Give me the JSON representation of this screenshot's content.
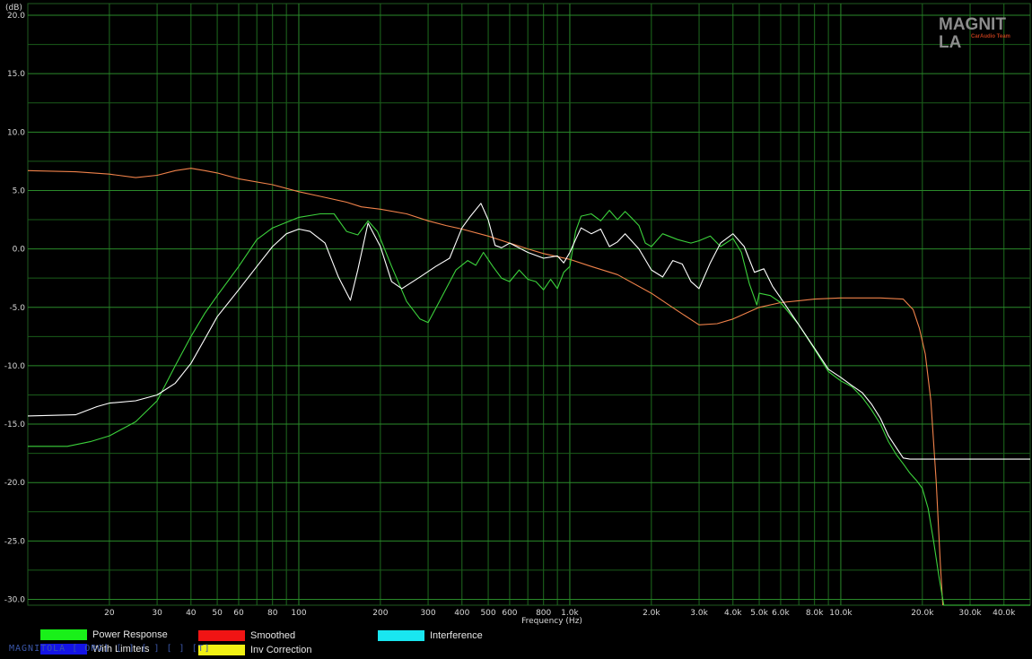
{
  "chart_data": {
    "type": "line",
    "xscale": "log",
    "xlim": [
      10,
      50000
    ],
    "ylim": [
      -30.5,
      21
    ],
    "ylabel": "(dB)",
    "xlabel": "Frequency (Hz)",
    "grid": true,
    "legend_position": "bottom",
    "y_ticks": [
      "20.0",
      "15.0",
      "10.0",
      "5.0",
      "0.0",
      "-5.0",
      "-10.0",
      "-15.0",
      "-20.0",
      "-25.0",
      "-30.0"
    ],
    "x_ticks": [
      {
        "f": 20,
        "label": "20"
      },
      {
        "f": 30,
        "label": "30"
      },
      {
        "f": 40,
        "label": "40"
      },
      {
        "f": 50,
        "label": "50"
      },
      {
        "f": 60,
        "label": "60"
      },
      {
        "f": 80,
        "label": "80"
      },
      {
        "f": 100,
        "label": "100"
      },
      {
        "f": 200,
        "label": "200"
      },
      {
        "f": 300,
        "label": "300"
      },
      {
        "f": 400,
        "label": "400"
      },
      {
        "f": 500,
        "label": "500"
      },
      {
        "f": 600,
        "label": "600"
      },
      {
        "f": 800,
        "label": "800"
      },
      {
        "f": 1000,
        "label": "1.0k"
      },
      {
        "f": 2000,
        "label": "2.0k"
      },
      {
        "f": 3000,
        "label": "3.0k"
      },
      {
        "f": 4000,
        "label": "4.0k"
      },
      {
        "f": 5000,
        "label": "5.0k"
      },
      {
        "f": 6000,
        "label": "6.0k"
      },
      {
        "f": 8000,
        "label": "8.0k"
      },
      {
        "f": 10000,
        "label": "10.0k"
      },
      {
        "f": 20000,
        "label": "20.0k"
      },
      {
        "f": 30000,
        "label": "30.0k"
      },
      {
        "f": 40000,
        "label": "40.0k"
      }
    ],
    "series": [
      {
        "name": "Inv Correction",
        "color": "#f0824a",
        "points": [
          [
            10,
            6.7
          ],
          [
            15,
            6.6
          ],
          [
            20,
            6.4
          ],
          [
            25,
            6.1
          ],
          [
            30,
            6.3
          ],
          [
            35,
            6.7
          ],
          [
            40,
            6.9
          ],
          [
            45,
            6.7
          ],
          [
            50,
            6.5
          ],
          [
            60,
            6.0
          ],
          [
            80,
            5.5
          ],
          [
            100,
            4.9
          ],
          [
            120,
            4.5
          ],
          [
            150,
            4.0
          ],
          [
            170,
            3.6
          ],
          [
            200,
            3.4
          ],
          [
            250,
            3.0
          ],
          [
            300,
            2.4
          ],
          [
            350,
            2.0
          ],
          [
            400,
            1.7
          ],
          [
            500,
            1.1
          ],
          [
            600,
            0.5
          ],
          [
            700,
            0.0
          ],
          [
            800,
            -0.4
          ],
          [
            1000,
            -0.9
          ],
          [
            1200,
            -1.5
          ],
          [
            1500,
            -2.2
          ],
          [
            2000,
            -3.8
          ],
          [
            2500,
            -5.3
          ],
          [
            3000,
            -6.5
          ],
          [
            3500,
            -6.4
          ],
          [
            4000,
            -6.0
          ],
          [
            5000,
            -5.0
          ],
          [
            6000,
            -4.6
          ],
          [
            8000,
            -4.3
          ],
          [
            10000,
            -4.2
          ],
          [
            14000,
            -4.2
          ],
          [
            17000,
            -4.3
          ],
          [
            18500,
            -5.2
          ],
          [
            19500,
            -6.8
          ],
          [
            20500,
            -9.0
          ],
          [
            21500,
            -13.0
          ],
          [
            22500,
            -20.0
          ],
          [
            23300,
            -27.0
          ],
          [
            23800,
            -30.5
          ]
        ]
      },
      {
        "name": "Power Response",
        "color": "#3cd23c",
        "points": [
          [
            10,
            -16.9
          ],
          [
            14,
            -16.9
          ],
          [
            17,
            -16.5
          ],
          [
            20,
            -16.0
          ],
          [
            25,
            -14.8
          ],
          [
            30,
            -13.0
          ],
          [
            35,
            -10.0
          ],
          [
            40,
            -7.5
          ],
          [
            45,
            -5.5
          ],
          [
            50,
            -4.0
          ],
          [
            60,
            -1.5
          ],
          [
            70,
            0.8
          ],
          [
            80,
            1.8
          ],
          [
            100,
            2.7
          ],
          [
            120,
            3.0
          ],
          [
            135,
            3.0
          ],
          [
            150,
            1.5
          ],
          [
            165,
            1.2
          ],
          [
            180,
            2.4
          ],
          [
            195,
            1.5
          ],
          [
            220,
            -1.5
          ],
          [
            250,
            -4.5
          ],
          [
            280,
            -6.0
          ],
          [
            300,
            -6.3
          ],
          [
            330,
            -4.5
          ],
          [
            380,
            -1.8
          ],
          [
            420,
            -1.0
          ],
          [
            450,
            -1.4
          ],
          [
            480,
            -0.3
          ],
          [
            520,
            -1.5
          ],
          [
            560,
            -2.5
          ],
          [
            600,
            -2.8
          ],
          [
            650,
            -1.8
          ],
          [
            700,
            -2.6
          ],
          [
            750,
            -2.8
          ],
          [
            800,
            -3.5
          ],
          [
            850,
            -2.6
          ],
          [
            900,
            -3.4
          ],
          [
            950,
            -2.0
          ],
          [
            1000,
            -1.5
          ],
          [
            1050,
            1.5
          ],
          [
            1100,
            2.8
          ],
          [
            1200,
            3.0
          ],
          [
            1300,
            2.4
          ],
          [
            1400,
            3.3
          ],
          [
            1500,
            2.5
          ],
          [
            1600,
            3.2
          ],
          [
            1700,
            2.6
          ],
          [
            1800,
            2.0
          ],
          [
            1900,
            0.5
          ],
          [
            2000,
            0.2
          ],
          [
            2200,
            1.3
          ],
          [
            2500,
            0.8
          ],
          [
            2800,
            0.5
          ],
          [
            3000,
            0.7
          ],
          [
            3300,
            1.1
          ],
          [
            3600,
            0.2
          ],
          [
            4000,
            0.9
          ],
          [
            4300,
            -0.3
          ],
          [
            4600,
            -3.0
          ],
          [
            4900,
            -4.8
          ],
          [
            5000,
            -3.8
          ],
          [
            5500,
            -4.0
          ],
          [
            6000,
            -4.6
          ],
          [
            7000,
            -6.5
          ],
          [
            8000,
            -8.6
          ],
          [
            9000,
            -10.5
          ],
          [
            10000,
            -11.3
          ],
          [
            11000,
            -11.8
          ],
          [
            12000,
            -12.7
          ],
          [
            13000,
            -13.8
          ],
          [
            14000,
            -15.0
          ],
          [
            15000,
            -16.5
          ],
          [
            16000,
            -17.6
          ],
          [
            17000,
            -18.4
          ],
          [
            18000,
            -19.2
          ],
          [
            19000,
            -19.8
          ],
          [
            20000,
            -20.5
          ],
          [
            21000,
            -22.2
          ],
          [
            22000,
            -25.0
          ],
          [
            23000,
            -28.0
          ],
          [
            24000,
            -30.5
          ],
          [
            50000,
            -30.5
          ]
        ]
      },
      {
        "name": "",
        "color": "#ffffff",
        "points": [
          [
            10,
            -14.3
          ],
          [
            15,
            -14.2
          ],
          [
            18,
            -13.5
          ],
          [
            20,
            -13.2
          ],
          [
            25,
            -13.0
          ],
          [
            30,
            -12.5
          ],
          [
            35,
            -11.5
          ],
          [
            40,
            -9.8
          ],
          [
            45,
            -7.7
          ],
          [
            50,
            -5.8
          ],
          [
            60,
            -3.5
          ],
          [
            70,
            -1.5
          ],
          [
            80,
            0.2
          ],
          [
            90,
            1.3
          ],
          [
            100,
            1.7
          ],
          [
            110,
            1.5
          ],
          [
            125,
            0.5
          ],
          [
            140,
            -2.4
          ],
          [
            155,
            -4.4
          ],
          [
            165,
            -1.8
          ],
          [
            180,
            2.2
          ],
          [
            200,
            0.2
          ],
          [
            220,
            -2.8
          ],
          [
            240,
            -3.4
          ],
          [
            280,
            -2.4
          ],
          [
            320,
            -1.5
          ],
          [
            360,
            -0.8
          ],
          [
            400,
            1.8
          ],
          [
            430,
            2.8
          ],
          [
            470,
            3.9
          ],
          [
            500,
            2.5
          ],
          [
            530,
            0.3
          ],
          [
            560,
            0.1
          ],
          [
            600,
            0.5
          ],
          [
            700,
            -0.3
          ],
          [
            800,
            -0.8
          ],
          [
            900,
            -0.6
          ],
          [
            950,
            -1.2
          ],
          [
            1000,
            -0.3
          ],
          [
            1050,
            0.8
          ],
          [
            1100,
            1.8
          ],
          [
            1200,
            1.3
          ],
          [
            1300,
            1.7
          ],
          [
            1400,
            0.2
          ],
          [
            1500,
            0.6
          ],
          [
            1600,
            1.3
          ],
          [
            1800,
            0.0
          ],
          [
            2000,
            -1.8
          ],
          [
            2200,
            -2.4
          ],
          [
            2400,
            -1.0
          ],
          [
            2600,
            -1.3
          ],
          [
            2800,
            -2.8
          ],
          [
            3000,
            -3.4
          ],
          [
            3300,
            -1.2
          ],
          [
            3600,
            0.5
          ],
          [
            4000,
            1.3
          ],
          [
            4400,
            0.2
          ],
          [
            4800,
            -2.0
          ],
          [
            5200,
            -1.7
          ],
          [
            5600,
            -3.2
          ],
          [
            6000,
            -4.2
          ],
          [
            7000,
            -6.5
          ],
          [
            8000,
            -8.5
          ],
          [
            9000,
            -10.3
          ],
          [
            10000,
            -11.0
          ],
          [
            11000,
            -11.7
          ],
          [
            12000,
            -12.3
          ],
          [
            13000,
            -13.3
          ],
          [
            14000,
            -14.5
          ],
          [
            15000,
            -16.0
          ],
          [
            16000,
            -17.0
          ],
          [
            17000,
            -17.9
          ],
          [
            18000,
            -18.0
          ],
          [
            50000,
            -18.0
          ]
        ]
      }
    ],
    "legend": [
      {
        "name": "Power Response",
        "color": "#19f019"
      },
      {
        "name": "With Limiters",
        "color": "#1414e6"
      },
      {
        "name": "Smoothed",
        "color": "#f01414"
      },
      {
        "name": "Inv Correction",
        "color": "#f0f014"
      },
      {
        "name": "Interference",
        "color": "#19e6f0"
      }
    ]
  },
  "logo": {
    "main": "MAGNIT  LA",
    "sub": "CarAudio Team"
  },
  "watermark": "MAGNITOLA [ ORG] [ ] [ ] [ ] [T]"
}
